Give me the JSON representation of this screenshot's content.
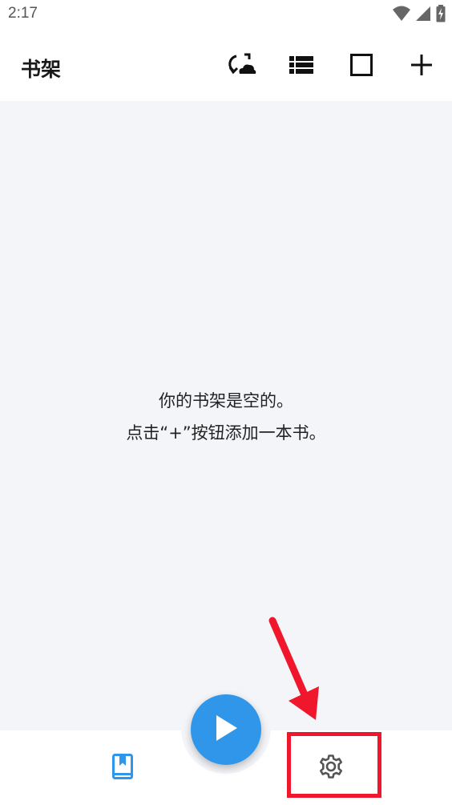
{
  "status_bar": {
    "time": "2:17",
    "icons": [
      "wifi-icon",
      "signal-icon",
      "battery-charging-icon"
    ]
  },
  "app_bar": {
    "title": "书架",
    "actions": [
      "sync-cloud-icon",
      "list-view-icon",
      "select-square-icon",
      "add-icon"
    ]
  },
  "empty_state": {
    "line1": "你的书架是空的。",
    "line2": "点击“+”按钮添加一本书。"
  },
  "fab": {
    "icon": "play-icon"
  },
  "bottom_nav": {
    "items": [
      {
        "icon": "bookshelf-icon",
        "active": true
      },
      {
        "icon": "gear-icon",
        "active": false
      }
    ]
  },
  "annotations": {
    "arrow_color": "#f0162c",
    "highlight_color": "#f0162c"
  },
  "colors": {
    "accent": "#2f96ea",
    "content_bg": "#f4f5f8"
  }
}
